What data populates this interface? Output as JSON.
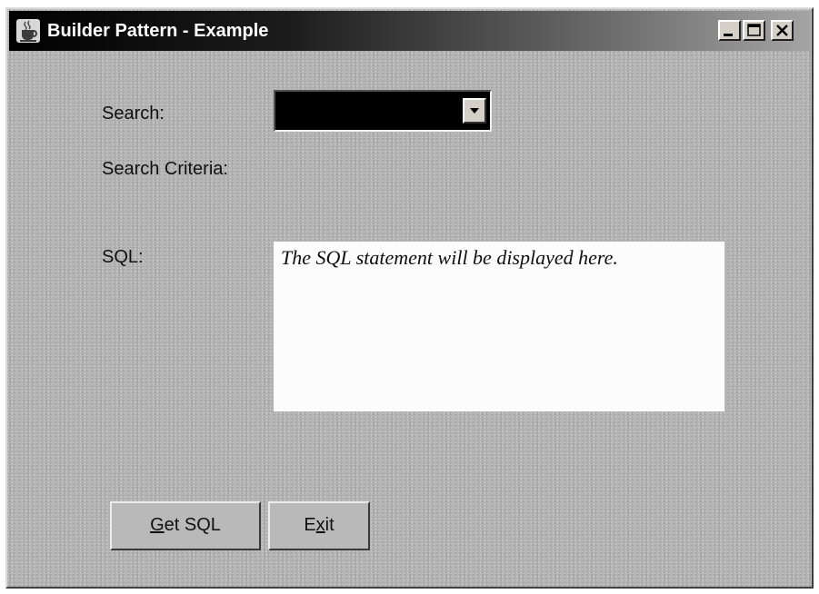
{
  "window": {
    "title": "Builder Pattern - Example",
    "controls": {
      "minimize_icon": "minimize-icon",
      "maximize_icon": "maximize-icon",
      "close_icon": "close-icon"
    },
    "app_icon": "java-cup-icon"
  },
  "form": {
    "search_label": "Search:",
    "search_value": "",
    "search_dropdown_icon": "chevron-down-icon",
    "criteria_label": "Search Criteria:",
    "sql_label": "SQL:",
    "sql_text": "The SQL statement will be displayed here."
  },
  "buttons": {
    "get_sql": {
      "label_prefix": "",
      "mnemonic": "G",
      "label_suffix": "et SQL"
    },
    "exit": {
      "label_prefix": "E",
      "mnemonic": "x",
      "label_suffix": "it"
    }
  },
  "colors": {
    "title_bar_start": "#000000",
    "title_bar_end": "#a4a4a4",
    "panel_background": "#b4b4b4",
    "combo_background": "#000000",
    "text_area_background": "#fcfcfc"
  }
}
